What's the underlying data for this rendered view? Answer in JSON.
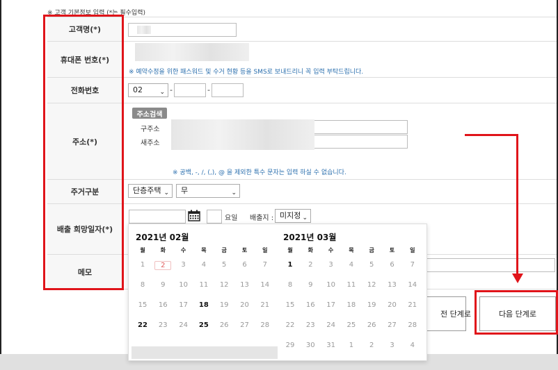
{
  "notice": "※ 고객 기본정보 입력 (*는 필수입력)",
  "labels": {
    "name": "고객명(*)",
    "mobile": "휴대폰 번호(*)",
    "phone": "전화번호",
    "address": "주소(*)",
    "housing": "주거구분",
    "date": "배출 희망일자(*)",
    "memo": "메모"
  },
  "hints": {
    "sms": "※ 예약수정을 위한 패스워드 및 수거 현황 등을 SMS로 보내드리니 꼭 입력 부탁드립니다.",
    "address": "※ 공백, -, /, (,), @ 을 제외한 특수 문자는 입력 하실 수 없습니다."
  },
  "phone": {
    "area_code": "02",
    "dash": "-"
  },
  "address": {
    "search_button": "주소검색",
    "old_label": "구주소",
    "new_label": "새주소"
  },
  "housing": {
    "type": "단층주택",
    "subtype": "무"
  },
  "date": {
    "weekday_label": "요일",
    "location_label": "배출지 :",
    "location_value": "미지정"
  },
  "calendar": {
    "weekdays": [
      "월",
      "화",
      "수",
      "목",
      "금",
      "토",
      "일"
    ],
    "months": [
      {
        "title": "2021년 02월",
        "weeks": [
          [
            "1",
            "2",
            "3",
            "4",
            "5",
            "6",
            "7"
          ],
          [
            "8",
            "9",
            "10",
            "11",
            "12",
            "13",
            "14"
          ],
          [
            "15",
            "16",
            "17",
            "18",
            "19",
            "20",
            "21"
          ],
          [
            "22",
            "23",
            "24",
            "25",
            "26",
            "27",
            "28"
          ]
        ],
        "active_days": [
          "18",
          "22",
          "25"
        ],
        "today": "2"
      },
      {
        "title": "2021년 03월",
        "weeks": [
          [
            "1",
            "2",
            "3",
            "4",
            "5",
            "6",
            "7"
          ],
          [
            "8",
            "9",
            "10",
            "11",
            "12",
            "13",
            "14"
          ],
          [
            "15",
            "16",
            "17",
            "18",
            "19",
            "20",
            "21"
          ],
          [
            "22",
            "23",
            "24",
            "25",
            "26",
            "27",
            "28"
          ],
          [
            "29",
            "30",
            "31",
            "1",
            "2",
            "3",
            "4"
          ]
        ],
        "active_days": [
          "1"
        ],
        "today": ""
      }
    ]
  },
  "buttons": {
    "prev": "전 단계로",
    "next": "다음 단계로"
  },
  "colors": {
    "highlight": "#e0141a",
    "hint": "#2b6fae"
  }
}
